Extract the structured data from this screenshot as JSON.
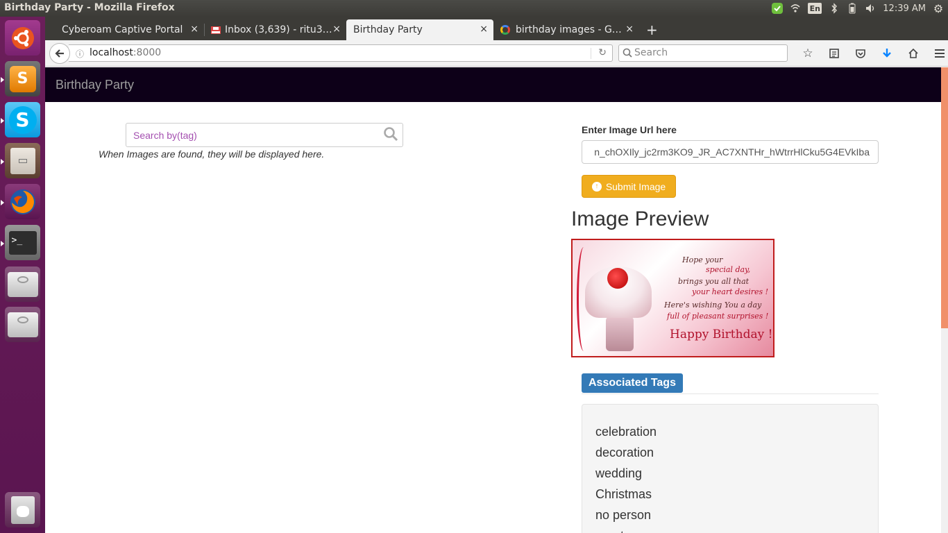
{
  "os": {
    "window_title": "Birthday Party - Mozilla Firefox",
    "keyboard_layout": "En",
    "clock": "12:39 AM"
  },
  "launcher": {
    "apps": [
      {
        "name": "ubuntu-dash-icon",
        "color": "#e95420"
      },
      {
        "name": "sublime-text-icon",
        "color": "#f89b1c"
      },
      {
        "name": "skype-icon",
        "color": "#00aff0"
      },
      {
        "name": "file-cabinet-icon",
        "color": "#c9c2b8"
      },
      {
        "name": "firefox-icon",
        "color": "#e66000"
      },
      {
        "name": "terminal-icon",
        "color": "#2d2d2d"
      },
      {
        "name": "drive-icon",
        "color": "#bdbdbd"
      },
      {
        "name": "drive-icon",
        "color": "#bdbdbd"
      },
      {
        "name": "trash-icon",
        "color": "#c8c8c8"
      }
    ]
  },
  "browser": {
    "tabs": [
      {
        "label": "Cyberoam Captive Portal",
        "active": false,
        "icon": ""
      },
      {
        "label": "Inbox (3,639) - ritu3…",
        "active": false,
        "icon": "gmail-icon"
      },
      {
        "label": "Birthday Party",
        "active": true,
        "icon": ""
      },
      {
        "label": "birthday images - G…",
        "active": false,
        "icon": "google-icon"
      }
    ],
    "new_tab_label": "+",
    "close_glyph": "×",
    "url_host": "localhost",
    "url_port": ":8000",
    "search_placeholder": "Search"
  },
  "page": {
    "brand": "Birthday Party",
    "tag_search_placeholder": "Search by(tag)",
    "hint": "When Images are found, they will be displayed here.",
    "url_label": "Enter Image Url here",
    "url_value": "n_chOXIly_jc2rm3KO9_JR_AC7XNTHr_hWtrrHlCku5G4EVkIba",
    "submit_label": "Submit Image",
    "preview_heading": "Image Preview",
    "card": {
      "line1": "Hope your",
      "line2": "special day,",
      "line3": "brings you all that",
      "line4": "your heart desires !",
      "line5": "Here's wishing You a day",
      "line6": "full of pleasant surprises !",
      "line7": "Happy Birthday !"
    },
    "tags_heading": "Associated Tags",
    "tags": [
      "celebration",
      "decoration",
      "wedding",
      "Christmas",
      "no person",
      "ornate"
    ]
  },
  "colors": {
    "launcher": "#5a1550",
    "navbar": "#0d0018",
    "accent_orange": "#f0ad1e",
    "label_blue": "#337ab7",
    "scroll_thumb": "#f0906a"
  }
}
